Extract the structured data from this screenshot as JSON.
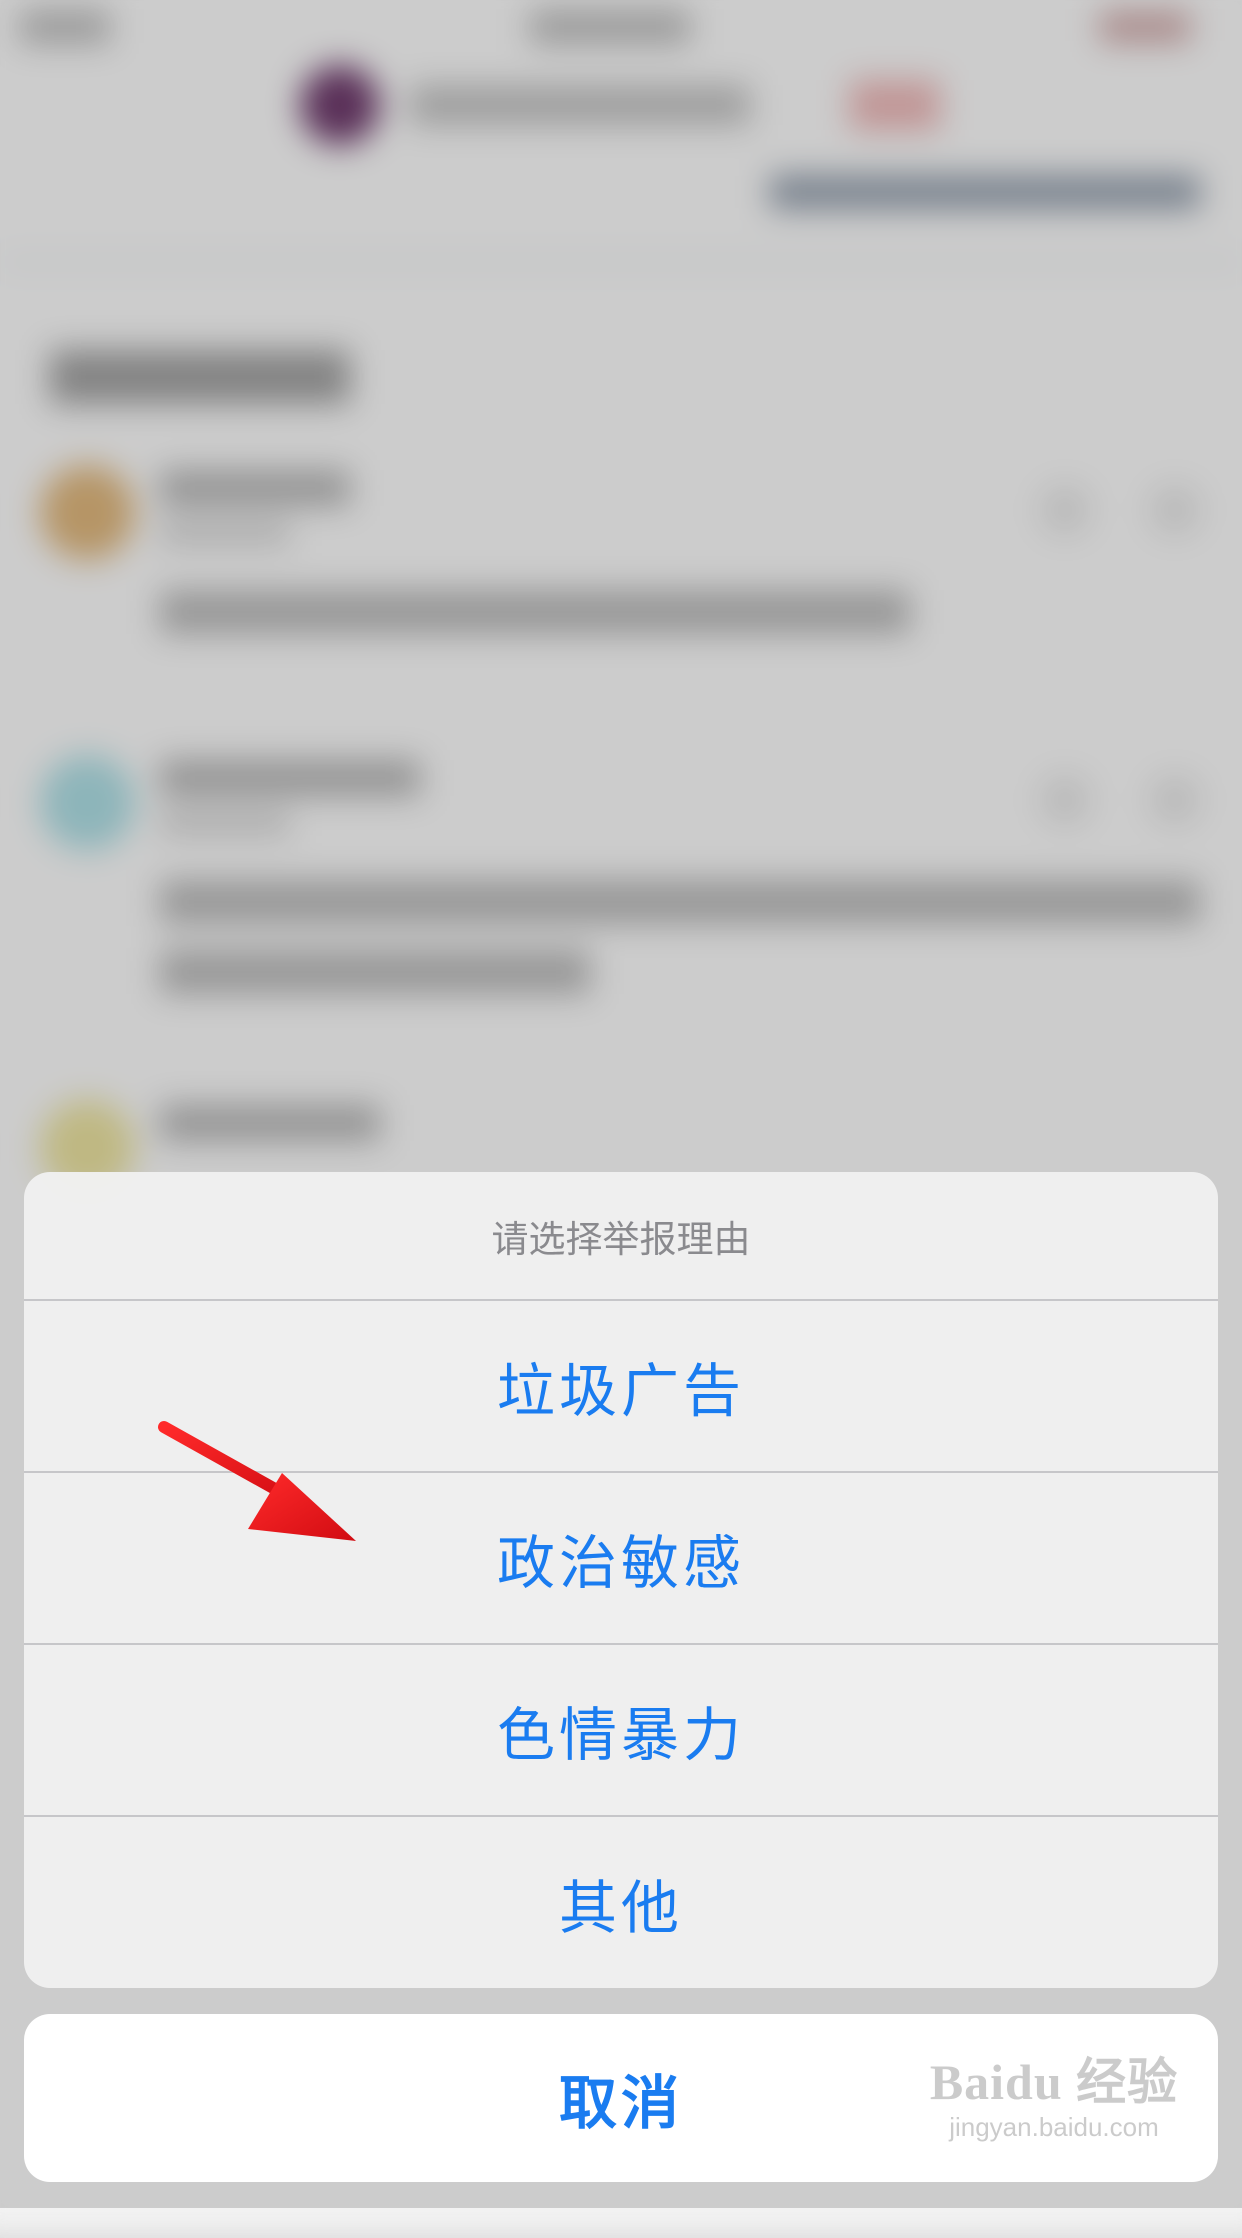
{
  "action_sheet": {
    "title": "请选择举报理由",
    "options": [
      {
        "label": "垃圾广告"
      },
      {
        "label": "政治敏感"
      },
      {
        "label": "色情暴力"
      },
      {
        "label": "其他"
      }
    ],
    "cancel_label": "取消"
  },
  "colors": {
    "accent": "#1a7cf0",
    "title_text": "#8a8a8e",
    "separator": "#c6c6c9",
    "annotation_arrow": "#e8141b"
  },
  "watermark": {
    "brand": "Baidu 经验",
    "url": "jingyan.baidu.com"
  }
}
